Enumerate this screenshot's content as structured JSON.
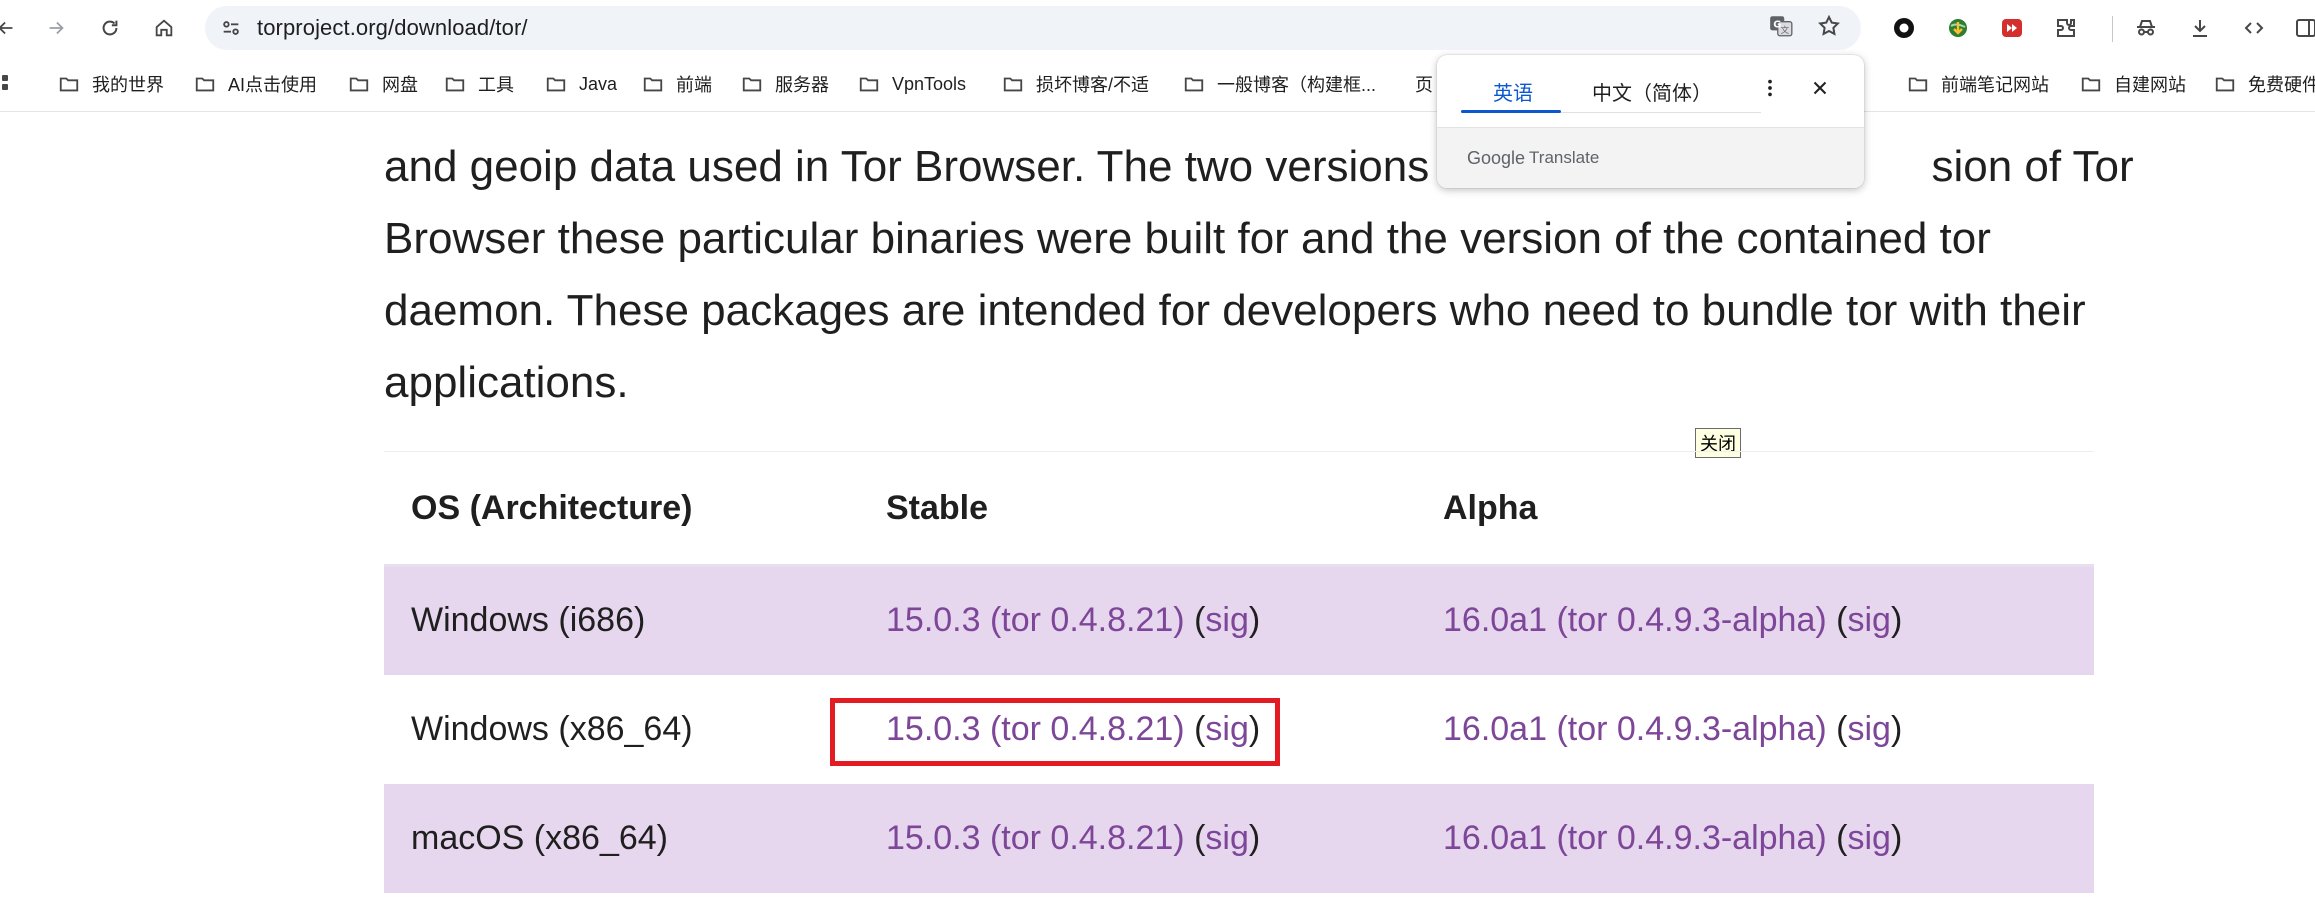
{
  "browser": {
    "url": "torproject.org/download/tor/"
  },
  "bookmarks": [
    {
      "label": "我的世界"
    },
    {
      "label": "AI点击使用"
    },
    {
      "label": "网盘"
    },
    {
      "label": "工具"
    },
    {
      "label": "Java"
    },
    {
      "label": "前端"
    },
    {
      "label": "服务器"
    },
    {
      "label": "VpnTools"
    },
    {
      "label": "损坏博客/不适"
    },
    {
      "label": "一般博客（构建框..."
    },
    {
      "label": "页"
    },
    {
      "label": "前端笔记网站"
    },
    {
      "label": "自建网站"
    },
    {
      "label": "免费硬件"
    }
  ],
  "translate_popup": {
    "tab_source": "英语",
    "tab_target": "中文（简体）",
    "footer_brand": "Google",
    "footer_text": "Translate"
  },
  "page": {
    "paragraph_lines": [
      "and geoip data used in Tor Browser. The two versions s",
      "sion of Tor",
      "Browser these particular binaries were built for and the version of the contained tor",
      "daemon. These packages are intended for developers who need to bundle tor with their",
      "applications."
    ],
    "close_tooltip": "关闭",
    "table": {
      "headers": [
        "OS (Architecture)",
        "Stable",
        "Alpha"
      ],
      "rows": [
        {
          "os": "Windows (i686)",
          "stable": "15.0.3 (tor 0.4.8.21)",
          "stable_sig": "sig",
          "alpha": "16.0a1 (tor 0.4.9.3-alpha)",
          "alpha_sig": "sig"
        },
        {
          "os": "Windows (x86_64)",
          "stable": "15.0.3 (tor 0.4.8.21)",
          "stable_sig": "sig",
          "alpha": "16.0a1 (tor 0.4.9.3-alpha)",
          "alpha_sig": "sig"
        },
        {
          "os": "macOS (x86_64)",
          "stable": "15.0.3 (tor 0.4.8.21)",
          "stable_sig": "sig",
          "alpha": "16.0a1 (tor 0.4.9.3-alpha)",
          "alpha_sig": "sig"
        }
      ]
    }
  },
  "colors": {
    "link": "#7d4698",
    "row_shade": "#e6d6ee",
    "highlight": "#e31b23",
    "translate_active": "#0b57d0"
  }
}
